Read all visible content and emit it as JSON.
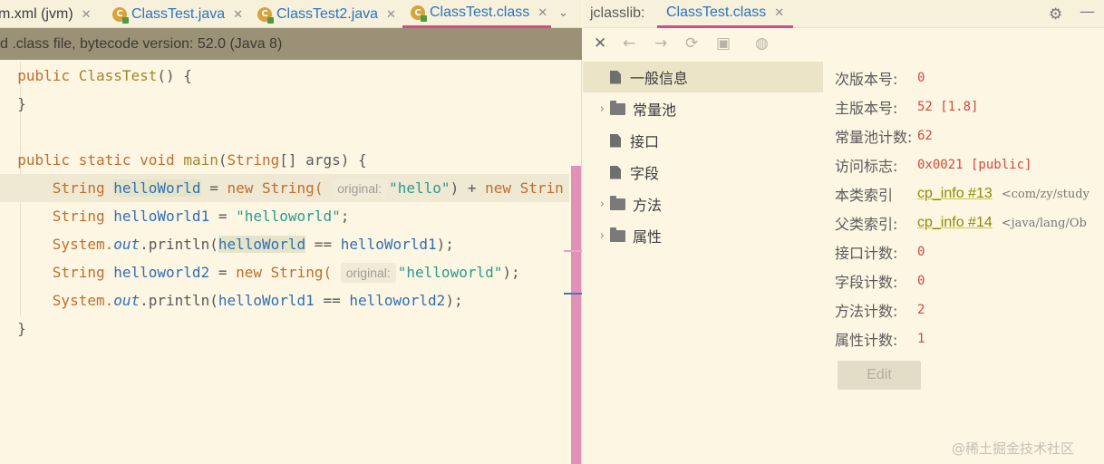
{
  "editor": {
    "tabs": [
      {
        "label": "m.xml (jvm)",
        "has_icon": false
      },
      {
        "label": "ClassTest.java",
        "has_icon": true
      },
      {
        "label": "ClassTest2.java",
        "has_icon": true
      },
      {
        "label": "ClassTest.class",
        "has_icon": true,
        "active": true
      }
    ],
    "banner": "d .class file, bytecode version: 52.0 (Java 8)",
    "hint_label": "original:",
    "code": {
      "l1_kw": "public",
      "l1_name": "ClassTest",
      "l1_rest": "() {",
      "l2": "}",
      "l3_public": "public",
      "l3_static": "static",
      "l3_void": "void",
      "l3_main": "main",
      "l3_string": "String",
      "l3_rest": "[] args) {",
      "l4_type": "String",
      "l4_var": "helloWorld",
      "l4_eq": " = ",
      "l4_new": "new",
      "l4_ctor": "String(",
      "l4_str": "\"hello\"",
      "l4_mid": ") + ",
      "l4_new2": "new",
      "l4_tail": "Strin",
      "l5_type": "String",
      "l5_var": "helloWorld1",
      "l5_eq": " = ",
      "l5_str": "\"helloworld\"",
      "l5_end": ";",
      "l6_sys": "System.",
      "l6_out": "out",
      "l6_println": ".println(",
      "l6_a": "helloWorld",
      "l6_op": " == ",
      "l6_b": "helloWorld1",
      "l6_end": ");",
      "l7_type": "String",
      "l7_var": "helloworld2",
      "l7_eq": " = ",
      "l7_new": "new",
      "l7_ctor": "String(",
      "l7_str": "\"helloworld\"",
      "l7_end": ");",
      "l8_sys": "System.",
      "l8_out": "out",
      "l8_println": ".println(",
      "l8_a": "helloWorld1",
      "l8_op": " == ",
      "l8_b": "helloworld2",
      "l8_end": ");",
      "l9": "}"
    }
  },
  "jclasslib": {
    "title": "jclasslib:",
    "tab": "ClassTest.class",
    "tree": [
      {
        "label": "一般信息",
        "kind": "file",
        "expandable": false,
        "selected": true
      },
      {
        "label": "常量池",
        "kind": "folder",
        "expandable": true
      },
      {
        "label": "接口",
        "kind": "file",
        "expandable": false
      },
      {
        "label": "字段",
        "kind": "file",
        "expandable": false
      },
      {
        "label": "方法",
        "kind": "folder",
        "expandable": true
      },
      {
        "label": "属性",
        "kind": "folder",
        "expandable": true
      }
    ],
    "details": {
      "minor_label": "次版本号:",
      "minor_value": "0",
      "major_label": "主版本号:",
      "major_value": "52 [1.8]",
      "cp_count_label": "常量池计数:",
      "cp_count_value": "62",
      "access_label": "访问标志:",
      "access_value": "0x0021 [public]",
      "this_label": "本类索引",
      "this_link": "cp_info #13",
      "this_extra": "<com/zy/study",
      "super_label": "父类索引:",
      "super_link": "cp_info #14",
      "super_extra": "<java/lang/Ob",
      "iface_label": "接口计数:",
      "iface_value": "0",
      "field_label": "字段计数:",
      "field_value": "0",
      "method_label": "方法计数:",
      "method_value": "2",
      "attr_label": "属性计数:",
      "attr_value": "1",
      "edit_button": "Edit"
    }
  },
  "watermark": "@稀土掘金技术社区",
  "colors": {
    "accent_pink": "#d24e86",
    "keyword": "#bf6e2e",
    "string": "#2a9a8c",
    "variable": "#2e6fb5",
    "value_red": "#d04a42"
  }
}
